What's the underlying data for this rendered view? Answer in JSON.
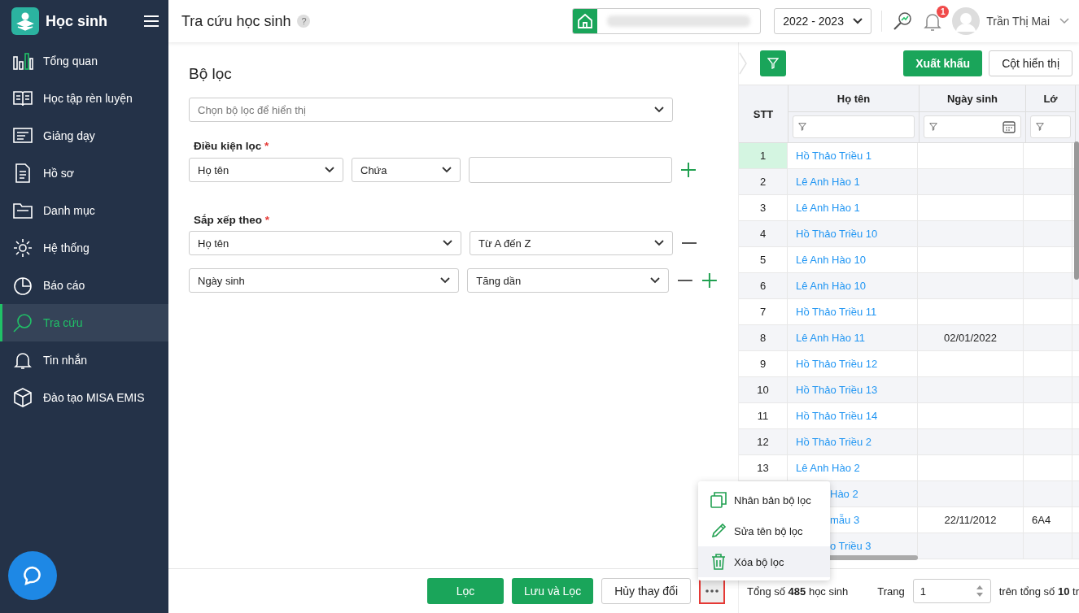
{
  "app": {
    "name": "Học sinh"
  },
  "sidebar": {
    "items": [
      {
        "label": "Tổng quan",
        "selected": false
      },
      {
        "label": "Học tập rèn luyện",
        "selected": false
      },
      {
        "label": "Giảng dạy",
        "selected": false
      },
      {
        "label": "Hồ sơ",
        "selected": false
      },
      {
        "label": "Danh mục",
        "selected": false
      },
      {
        "label": "Hệ thống",
        "selected": false
      },
      {
        "label": "Báo cáo",
        "selected": false
      },
      {
        "label": "Tra cứu",
        "selected": true
      },
      {
        "label": "Tin nhắn",
        "selected": false
      },
      {
        "label": "Đào tạo MISA EMIS",
        "selected": false
      }
    ]
  },
  "header": {
    "title": "Tra cứu học sinh",
    "help": "?",
    "school_year": "2022 - 2023",
    "notification_count": "1",
    "user": "Trần Thị Mai"
  },
  "filter": {
    "title": "Bộ lọc",
    "preset_placeholder": "Chọn bộ lọc để hiển thị",
    "conditions_label": "Điều kiện lọc",
    "conditions_required": "*",
    "conditions": [
      {
        "field": "Họ tên",
        "operator": "Chứa"
      }
    ],
    "sort_label": "Sắp xếp theo",
    "sort_required": "*",
    "sorts": [
      {
        "field": "Họ tên",
        "order": "Từ A đến Z",
        "can_add": false
      },
      {
        "field": "Ngày sinh",
        "order": "Tăng dần",
        "can_add": true
      }
    ]
  },
  "toolbar": {
    "export": "Xuất khẩu",
    "columns": "Cột hiển thị"
  },
  "table": {
    "columns": [
      "STT",
      "Họ tên",
      "Ngày sinh",
      "Lớ"
    ],
    "rows": [
      {
        "stt": "1",
        "name": "Hồ Thảo Triều 1",
        "dob": "",
        "class": "",
        "selected": true,
        "partial": false
      },
      {
        "stt": "2",
        "name": "Lê Anh Hào 1",
        "dob": "",
        "class": "",
        "selected": false,
        "partial": false
      },
      {
        "stt": "3",
        "name": "Lê Anh Hào 1",
        "dob": "",
        "class": "",
        "selected": false,
        "partial": false
      },
      {
        "stt": "4",
        "name": "Hồ Thảo Triều 10",
        "dob": "",
        "class": "",
        "selected": false,
        "partial": false
      },
      {
        "stt": "5",
        "name": "Lê Anh Hào 10",
        "dob": "",
        "class": "",
        "selected": false,
        "partial": false
      },
      {
        "stt": "6",
        "name": "Lê Anh Hào 10",
        "dob": "",
        "class": "",
        "selected": false,
        "partial": false
      },
      {
        "stt": "7",
        "name": "Hồ Thảo Triều 11",
        "dob": "",
        "class": "",
        "selected": false,
        "partial": false
      },
      {
        "stt": "8",
        "name": "Lê Anh Hào 11",
        "dob": "02/01/2022",
        "class": "",
        "selected": false,
        "partial": false
      },
      {
        "stt": "9",
        "name": "Hồ Thảo Triều 12",
        "dob": "",
        "class": "",
        "selected": false,
        "partial": false
      },
      {
        "stt": "10",
        "name": "Hồ Thảo Triều 13",
        "dob": "",
        "class": "",
        "selected": false,
        "partial": false
      },
      {
        "stt": "11",
        "name": "Hồ Thảo Triều 14",
        "dob": "",
        "class": "",
        "selected": false,
        "partial": false
      },
      {
        "stt": "12",
        "name": "Hồ Thảo Triều 2",
        "dob": "",
        "class": "",
        "selected": false,
        "partial": false
      },
      {
        "stt": "13",
        "name": "Lê Anh Hào 2",
        "dob": "",
        "class": "",
        "selected": false,
        "partial": false
      },
      {
        "name": "Hào 2",
        "partial": true
      },
      {
        "name": "mẫu 3",
        "dob": "22/11/2012",
        "class": "6A4",
        "partial": true
      },
      {
        "name": "o Triều 3",
        "partial": true
      }
    ]
  },
  "menu": {
    "items": [
      {
        "label": "Nhân bản bộ lọc",
        "selected": false
      },
      {
        "label": "Sửa tên bộ lọc",
        "selected": false
      },
      {
        "label": "Xóa bộ lọc",
        "selected": true
      }
    ]
  },
  "footer": {
    "buttons": [
      {
        "label": "Lọc",
        "kind": "primary"
      },
      {
        "label": "Lưu và Lọc",
        "kind": "primary"
      },
      {
        "label": "Hủy thay đổi",
        "kind": "secondary"
      }
    ],
    "more_highlighted": true,
    "total": "Tổng số **485** học sinh",
    "page_label": "Trang",
    "page": "1",
    "page_total": "trên tổng số **10** tr"
  }
}
